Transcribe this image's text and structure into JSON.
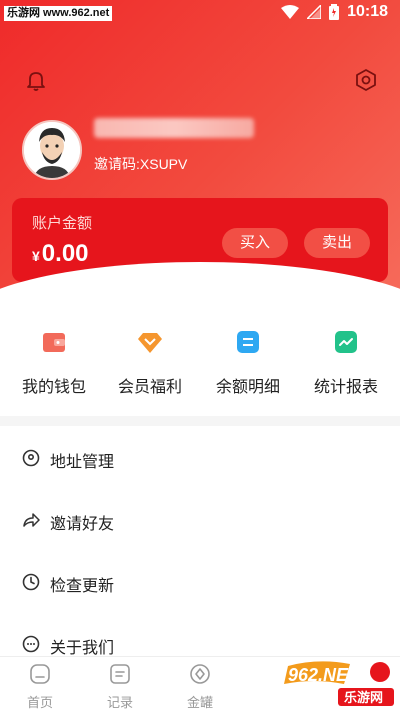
{
  "status_bar": {
    "watermark": "乐游网 www.962.net",
    "time": "10:18"
  },
  "header": {
    "invite_code": "邀请码:XSUPV"
  },
  "balance": {
    "label": "账户金额",
    "currency": "¥",
    "amount": "0.00",
    "buy_label": "买入",
    "sell_label": "卖出"
  },
  "actions": [
    {
      "label": "我的钱包",
      "icon": "wallet-icon",
      "color": "#f26a5a"
    },
    {
      "label": "会员福利",
      "icon": "diamond-icon",
      "color": "#f5962e"
    },
    {
      "label": "余额明细",
      "icon": "detail-icon",
      "color": "#2ea8f2"
    },
    {
      "label": "统计报表",
      "icon": "chart-icon",
      "color": "#22c28a"
    }
  ],
  "menu": [
    {
      "label": "地址管理",
      "icon": "location-icon"
    },
    {
      "label": "邀请好友",
      "icon": "share-icon"
    },
    {
      "label": "检查更新",
      "icon": "clock-icon"
    },
    {
      "label": "关于我们",
      "icon": "info-icon"
    }
  ],
  "tabs": [
    {
      "label": "首页",
      "icon": "home-icon"
    },
    {
      "label": "记录",
      "icon": "record-icon"
    },
    {
      "label": "金罐",
      "icon": "jar-icon"
    }
  ],
  "footer_watermark": {
    "brand": "962.NET",
    "site": "乐游网"
  },
  "colors": {
    "primary": "#e6151c",
    "header_gradient_end": "#f66a5a"
  }
}
